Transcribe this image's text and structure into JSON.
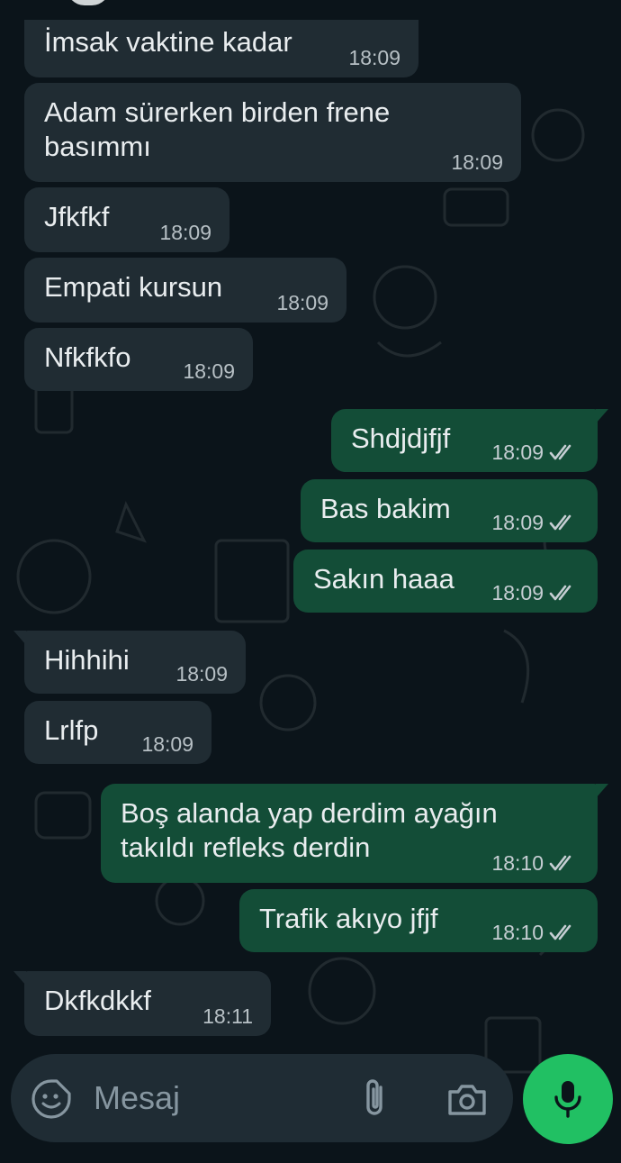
{
  "messages": [
    {
      "dir": "in",
      "text": "İmsak vaktine kadar",
      "time": "18:09"
    },
    {
      "dir": "in",
      "text": "Adam sürerken birden frene basımmı",
      "time": "18:09"
    },
    {
      "dir": "in",
      "text": "Jfkfkf",
      "time": "18:09"
    },
    {
      "dir": "in",
      "text": "Empati kursun",
      "time": "18:09"
    },
    {
      "dir": "in",
      "text": "Nfkfkfo",
      "time": "18:09"
    },
    {
      "dir": "out",
      "text": "Shdjdjfjf",
      "time": "18:09",
      "status": "read"
    },
    {
      "dir": "out",
      "text": "Bas bakim",
      "time": "18:09",
      "status": "read"
    },
    {
      "dir": "out",
      "text": "Sakın haaa",
      "time": "18:09",
      "status": "read"
    },
    {
      "dir": "in",
      "text": "Hihhihi",
      "time": "18:09"
    },
    {
      "dir": "in",
      "text": "Lrlfp",
      "time": "18:09"
    },
    {
      "dir": "out",
      "text": "Boş alanda yap derdim ayağın takıldı refleks derdin",
      "time": "18:10",
      "status": "read"
    },
    {
      "dir": "out",
      "text": "Trafik akıyo jfjf",
      "time": "18:10",
      "status": "read"
    },
    {
      "dir": "in",
      "text": "Dkfkdkkf",
      "time": "18:11"
    }
  ],
  "composer": {
    "placeholder": "Mesaj",
    "icons": {
      "emoji": "sticker-emoji-icon",
      "attach": "paperclip-icon",
      "camera": "camera-icon",
      "mic": "microphone-icon"
    }
  },
  "colors": {
    "background": "#0b141a",
    "incoming_bubble": "#202c33",
    "outgoing_bubble": "#134d37",
    "accent": "#21c063",
    "read_ticks": "#c6ced3"
  }
}
